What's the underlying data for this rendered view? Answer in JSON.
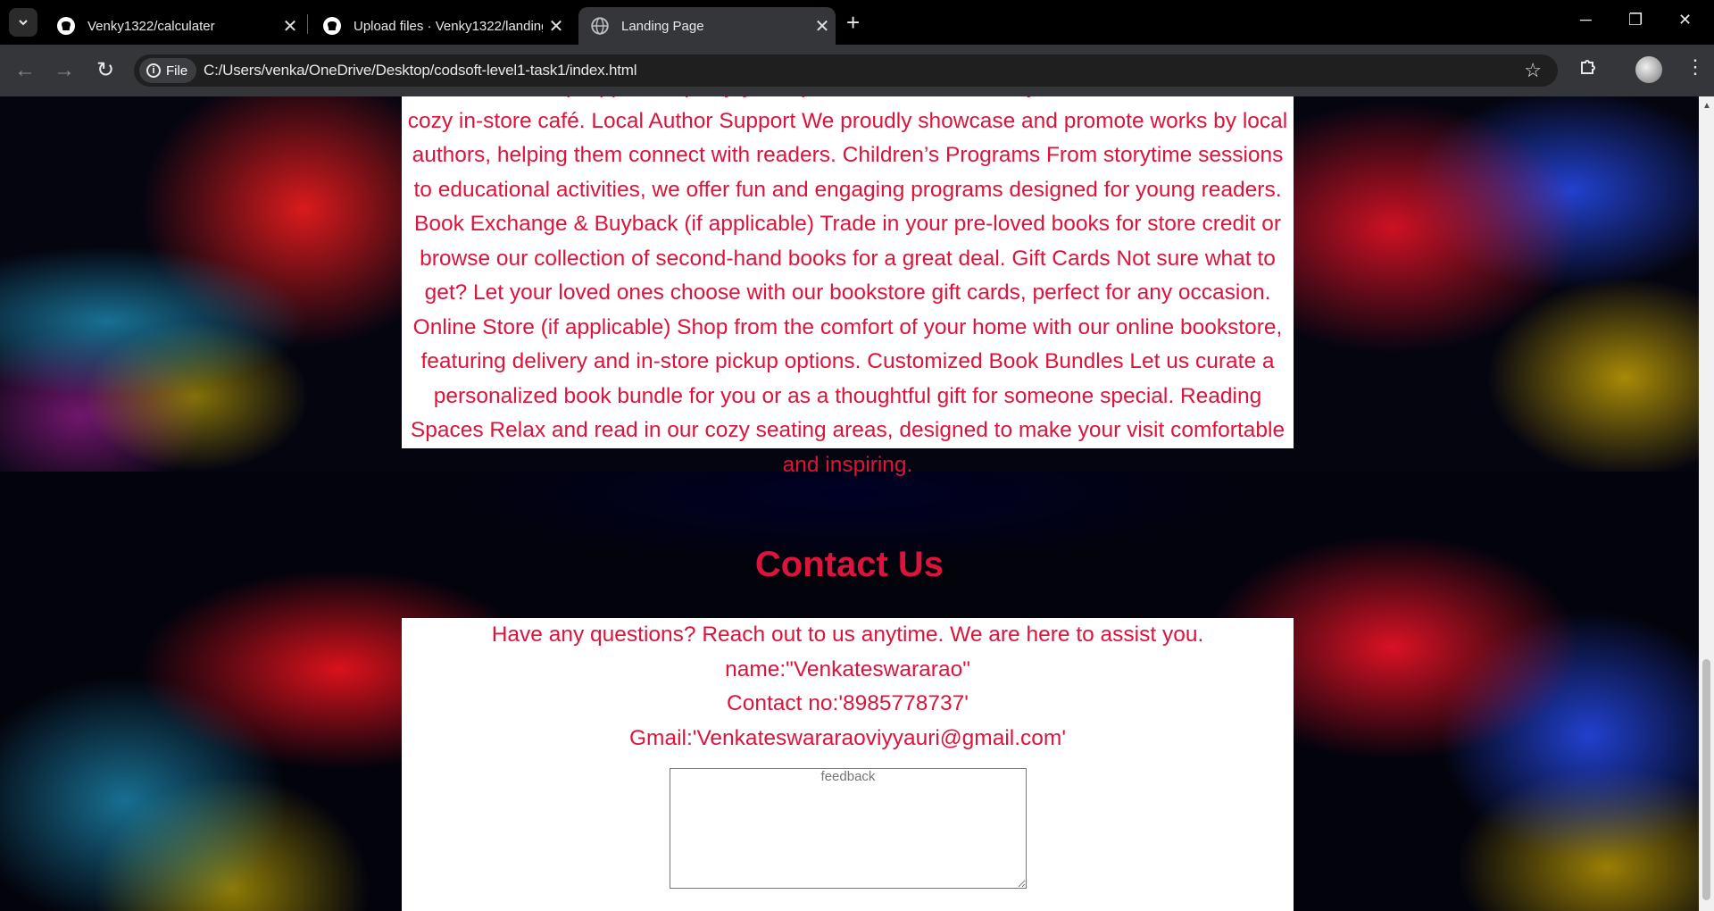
{
  "browser": {
    "tabs": [
      {
        "title": "Venky1322/calculater",
        "icon": "github-icon",
        "close": "✕"
      },
      {
        "title": "Upload files · Venky1322/landing",
        "icon": "github-icon",
        "close": "✕"
      },
      {
        "title": "Landing Page",
        "icon": "globe-icon",
        "close": "✕",
        "active": true
      }
    ],
    "new_tab": "+",
    "window_controls": {
      "minimize": "─",
      "restore": "❐",
      "close": "✕"
    },
    "back": "←",
    "forward": "→",
    "reload": "↻",
    "scheme_chip": "File",
    "url": "C:/Users/venka/OneDrive/Desktop/codsoft-level1-task1/index.html",
    "bookmark": "☆"
  },
  "page": {
    "services_text": "Coffee Corner (if applicable) Enjoy a cup of coffee or tea while you browse or read at our cozy in-store café. Local Author Support We proudly showcase and promote works by local authors, helping them connect with readers. Children’s Programs From storytime sessions to educational activities, we offer fun and engaging programs designed for young readers. Book Exchange & Buyback (if applicable) Trade in your pre-loved books for store credit or browse our collection of second-hand books for a great deal. Gift Cards Not sure what to get? Let your loved ones choose with our bookstore gift cards, perfect for any occasion. Online Store (if applicable) Shop from the comfort of your home with our online bookstore, featuring delivery and in-store pickup options. Customized Book Bundles Let us curate a personalized book bundle for you or as a thoughtful gift for someone special. Reading Spaces Relax and read in our cozy seating areas, designed to make your visit comfortable and inspiring.",
    "contact": {
      "title": "Contact Us",
      "intro": "Have any questions? Reach out to us anytime. We are here to assist you.",
      "name": "name:\"Venkateswararao\"",
      "phone": "Contact no:'8985778737'",
      "gmail": "Gmail:'Venkateswararaoviyyauri@gmail.com'",
      "feedback_placeholder": "feedback"
    },
    "text_color": "#dc143c"
  }
}
